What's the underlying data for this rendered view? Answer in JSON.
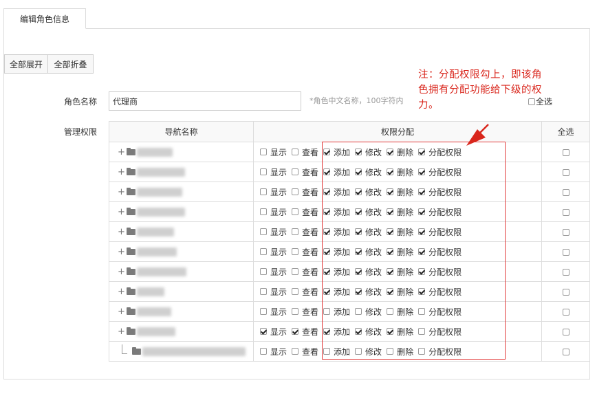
{
  "tab": {
    "label": "编辑角色信息"
  },
  "toolbar": {
    "expand_all": "全部展开",
    "collapse_all": "全部折叠"
  },
  "form": {
    "role_name_label": "角色名称",
    "role_name_value": "代理商",
    "role_name_hint": "*角色中文名称，100字符内",
    "select_all_label": "全选",
    "perm_label": "管理权限"
  },
  "annotation": {
    "text": "注：分配权限勾上，即该角色拥有分配功能给下级的权力。",
    "color": "#d9261c"
  },
  "table": {
    "headers": {
      "nav": "导航名称",
      "perm": "权限分配",
      "select_all": "全选"
    },
    "perm_labels": [
      "显示",
      "查看",
      "添加",
      "修改",
      "删除",
      "分配权限"
    ],
    "rows": [
      {
        "node": "expandable",
        "checks": [
          false,
          false,
          true,
          true,
          true,
          true
        ],
        "select_all": false
      },
      {
        "node": "expandable",
        "checks": [
          false,
          false,
          true,
          true,
          true,
          true
        ],
        "select_all": false
      },
      {
        "node": "expandable",
        "checks": [
          false,
          false,
          true,
          true,
          true,
          true
        ],
        "select_all": false
      },
      {
        "node": "expandable",
        "checks": [
          false,
          false,
          true,
          true,
          true,
          true
        ],
        "select_all": false
      },
      {
        "node": "expandable",
        "checks": [
          false,
          false,
          true,
          true,
          true,
          true
        ],
        "select_all": false
      },
      {
        "node": "expandable",
        "checks": [
          false,
          false,
          true,
          true,
          true,
          true
        ],
        "select_all": false
      },
      {
        "node": "expandable",
        "checks": [
          false,
          false,
          true,
          true,
          true,
          true
        ],
        "select_all": false
      },
      {
        "node": "expandable",
        "checks": [
          false,
          false,
          true,
          true,
          true,
          true
        ],
        "select_all": false
      },
      {
        "node": "expandable",
        "checks": [
          false,
          false,
          false,
          false,
          false,
          false
        ],
        "select_all": false
      },
      {
        "node": "expandable",
        "checks": [
          true,
          true,
          true,
          true,
          true,
          false
        ],
        "select_all": false
      },
      {
        "node": "child",
        "checks": [
          false,
          false,
          false,
          false,
          false,
          false
        ],
        "select_all": false
      }
    ]
  },
  "icons": {
    "expand": "plus-icon",
    "folder": "folder-icon",
    "tree_branch": "tree-branch-icon"
  }
}
